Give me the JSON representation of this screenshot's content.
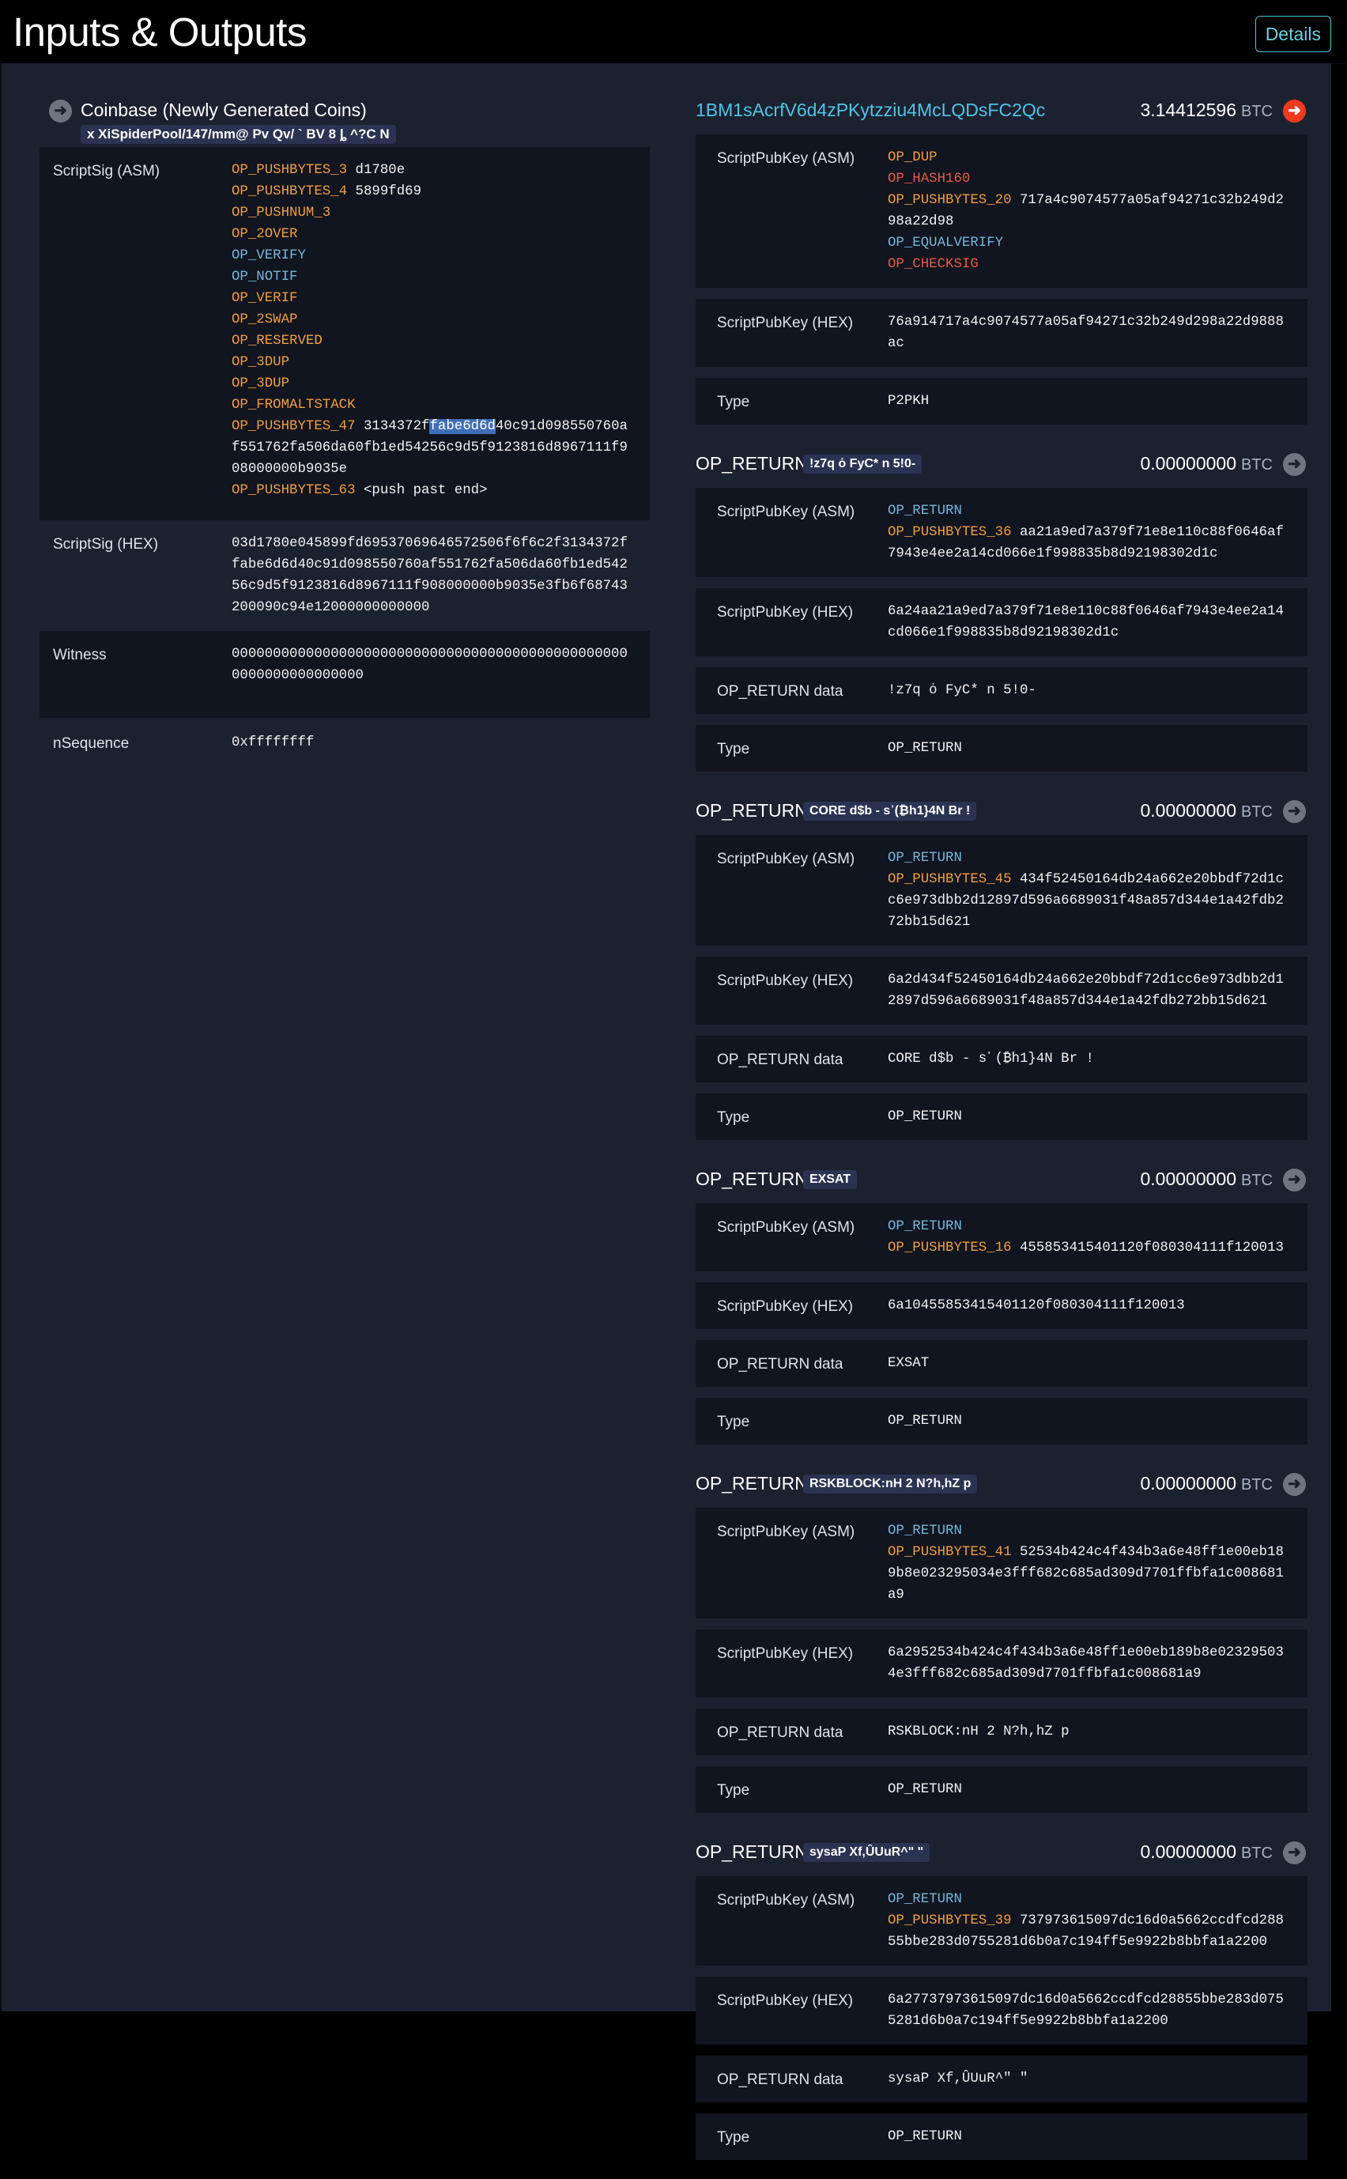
{
  "header": {
    "title": "Inputs & Outputs",
    "details_label": "Details"
  },
  "input": {
    "title": "Coinbase (Newly Generated Coins)",
    "tag": "x  XiSpiderPool/147/mm@ Pv Qv/ ` BV 8 ȴ  ^?C N",
    "scriptsig_asm_label": "ScriptSig (ASM)",
    "scriptsig_asm": [
      {
        "op": "OP_PUSHBYTES_3",
        "c": "o",
        "data": "d1780e"
      },
      {
        "op": "OP_PUSHBYTES_4",
        "c": "o",
        "data": "5899fd69"
      },
      {
        "op": "OP_PUSHNUM_3",
        "c": "o",
        "data": ""
      },
      {
        "op": "OP_2OVER",
        "c": "o",
        "data": ""
      },
      {
        "op": "OP_VERIFY",
        "c": "b",
        "data": ""
      },
      {
        "op": "OP_NOTIF",
        "c": "b",
        "data": ""
      },
      {
        "op": "OP_VERIF",
        "c": "o",
        "data": ""
      },
      {
        "op": "OP_2SWAP",
        "c": "o",
        "data": ""
      },
      {
        "op": "OP_RESERVED",
        "c": "o",
        "data": ""
      },
      {
        "op": "OP_3DUP",
        "c": "o",
        "data": ""
      },
      {
        "op": "OP_3DUP",
        "c": "o",
        "data": ""
      },
      {
        "op": "OP_FROMALTSTACK",
        "c": "o",
        "data": ""
      },
      {
        "op": "OP_PUSHBYTES_47",
        "c": "o",
        "data": "3134372ffabe6d6d40c91d098550760af551762fa506da60fb1ed54256c9d5f9123816d8967111f908000000b9035e"
      },
      {
        "op": "OP_PUSHBYTES_63",
        "c": "o",
        "data": "<push past end>"
      }
    ],
    "scriptsig_hex_label": "ScriptSig (HEX)",
    "scriptsig_hex": "03d1780e045899fd69537069646572506f6f6c2f3134372ffabe6d6d40c91d098550760af551762fa506da60fb1ed54256c9d5f9123816d8967111f908000000b9035e3fb6f68743200090c94e12000000000000",
    "witness_label": "Witness",
    "witness": "0000000000000000000000000000000000000000000000000000000000000000",
    "nsequence_label": "nSequence",
    "nsequence": "0xffffffff"
  },
  "outputs": [
    {
      "title": "1BM1sAcrfV6d4zPKytzziu4McLQDsFC2Qc",
      "amount": "3.14412596",
      "unit": "BTC",
      "asm_label": "ScriptPubKey (ASM)",
      "asm": [
        {
          "op": "OP_DUP",
          "c": "o",
          "data": ""
        },
        {
          "op": "OP_HASH160",
          "c": "r",
          "data": ""
        },
        {
          "op": "OP_PUSHBYTES_20",
          "c": "o",
          "data": "717a4c9074577a05af94271c32b249d298a22d98"
        },
        {
          "op": "OP_EQUALVERIFY",
          "c": "b",
          "data": ""
        },
        {
          "op": "OP_CHECKSIG",
          "c": "r",
          "data": ""
        }
      ],
      "hex_label": "ScriptPubKey (HEX)",
      "hex": "76a914717a4c9074577a05af94271c32b249d298a22d9888ac",
      "type_label": "Type",
      "type": "P2PKH"
    },
    {
      "title": "OP_RETURN",
      "tag": "!z7q ȯ FyC*  n 5!0-",
      "amount": "0.00000000",
      "unit": "BTC",
      "asm_label": "ScriptPubKey (ASM)",
      "asm": [
        {
          "op": "OP_RETURN",
          "c": "b",
          "data": ""
        },
        {
          "op": "OP_PUSHBYTES_36",
          "c": "o",
          "data": "aa21a9ed7a379f71e8e110c88f0646af7943e4ee2a14cd066e1f998835b8d92198302d1c"
        }
      ],
      "hex_label": "ScriptPubKey (HEX)",
      "hex": "6a24aa21a9ed7a379f71e8e110c88f0646af7943e4ee2a14cd066e1f998835b8d92198302d1c",
      "data_label": "OP_RETURN data",
      "data": "!z7q ȯ FyC*  n 5!0-",
      "type_label": "Type",
      "type": "OP_RETURN"
    },
    {
      "title": "OP_RETURN",
      "tag": "CORE d$b - s᾽(₿h1}4N Br !",
      "amount": "0.00000000",
      "unit": "BTC",
      "asm_label": "ScriptPubKey (ASM)",
      "asm": [
        {
          "op": "OP_RETURN",
          "c": "b",
          "data": ""
        },
        {
          "op": "OP_PUSHBYTES_45",
          "c": "o",
          "data": "434f52450164db24a662e20bbdf72d1cc6e973dbb2d12897d596a6689031f48a857d344e1a42fdb272bb15d621"
        }
      ],
      "hex_label": "ScriptPubKey (HEX)",
      "hex": "6a2d434f52450164db24a662e20bbdf72d1cc6e973dbb2d12897d596a6689031f48a857d344e1a42fdb272bb15d621",
      "data_label": "OP_RETURN data",
      "data": "CORE d$b - s᾽(₿h1}4N Br !",
      "type_label": "Type",
      "type": "OP_RETURN"
    },
    {
      "title": "OP_RETURN",
      "tag": "EXSAT",
      "amount": "0.00000000",
      "unit": "BTC",
      "asm_label": "ScriptPubKey (ASM)",
      "asm": [
        {
          "op": "OP_RETURN",
          "c": "b",
          "data": ""
        },
        {
          "op": "OP_PUSHBYTES_16",
          "c": "o",
          "data": "455853415401120f080304111f120013"
        }
      ],
      "hex_label": "ScriptPubKey (HEX)",
      "hex": "6a10455853415401120f080304111f120013",
      "data_label": "OP_RETURN data",
      "data": "EXSAT",
      "type_label": "Type",
      "type": "OP_RETURN"
    },
    {
      "title": "OP_RETURN",
      "tag": "RSKBLOCK:nH  2 N?h,hZ p",
      "amount": "0.00000000",
      "unit": "BTC",
      "asm_label": "ScriptPubKey (ASM)",
      "asm": [
        {
          "op": "OP_RETURN",
          "c": "b",
          "data": ""
        },
        {
          "op": "OP_PUSHBYTES_41",
          "c": "o",
          "data": "52534b424c4f434b3a6e48ff1e00eb189b8e023295034e3fff682c685ad309d7701ffbfa1c008681a9"
        }
      ],
      "hex_label": "ScriptPubKey (HEX)",
      "hex": "6a2952534b424c4f434b3a6e48ff1e00eb189b8e023295034e3fff682c685ad309d7701ffbfa1c008681a9",
      "data_label": "OP_RETURN data",
      "data": "RSKBLOCK:nH  2 N?h,hZ p",
      "type_label": "Type",
      "type": "OP_RETURN"
    },
    {
      "title": "OP_RETURN",
      "tag": "sysaP Xf,ȖUuR^\" \"",
      "amount": "0.00000000",
      "unit": "BTC",
      "asm_label": "ScriptPubKey (ASM)",
      "asm": [
        {
          "op": "OP_RETURN",
          "c": "b",
          "data": ""
        },
        {
          "op": "OP_PUSHBYTES_39",
          "c": "o",
          "data": "737973615097dc16d0a5662ccdfcd28855bbe283d0755281d6b0a7c194ff5e9922b8bbfa1a2200"
        }
      ],
      "hex_label": "ScriptPubKey (HEX)",
      "hex": "6a27737973615097dc16d0a5662ccdfcd28855bbe283d0755281d6b0a7c194ff5e9922b8bbfa1a2200",
      "data_label": "OP_RETURN data",
      "data": "sysaP Xf,ȖUuR^\" \"",
      "type_label": "Type",
      "type": "OP_RETURN"
    }
  ]
}
